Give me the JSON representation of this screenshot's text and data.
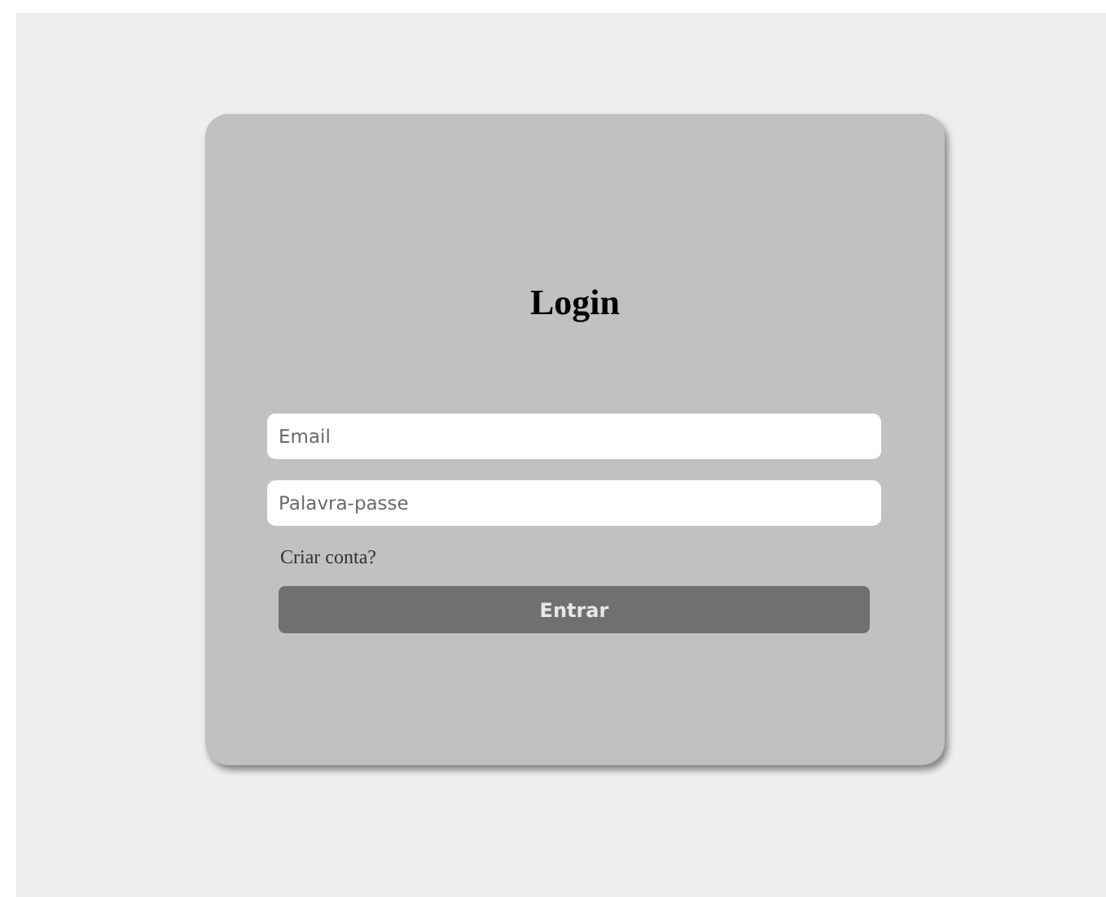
{
  "title": "Login",
  "fields": [
    {
      "placeholder": "Email"
    },
    {
      "placeholder": "Palavra-passe"
    }
  ],
  "link": "Criar conta?",
  "button": "Entrar"
}
